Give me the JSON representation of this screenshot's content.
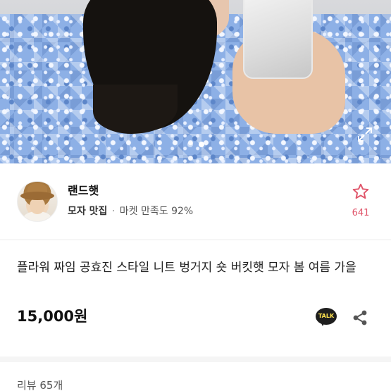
{
  "photo": {
    "alt": "product photo",
    "slide_count": 2,
    "active_slide": 2,
    "expand_icon": "expand-icon"
  },
  "seller": {
    "name": "랜드햇",
    "tag": "모자 맛집",
    "separator": "·",
    "satisfaction": "마켓 만족도 92%",
    "like_count": "641",
    "like_icon": "star-icon"
  },
  "product": {
    "title": "플라워 짜임 공효진 스타일 니트 벙거지 숏 버킷햇 모자 봄 여름 가을",
    "price": "15,000원",
    "talk_label": "TALK",
    "share_icon": "share-icon"
  },
  "review": {
    "label": "리뷰 65개"
  },
  "colors": {
    "accent": "#e0556a",
    "talk_bg": "#1e1e1e",
    "talk_text": "#ffe34f"
  }
}
